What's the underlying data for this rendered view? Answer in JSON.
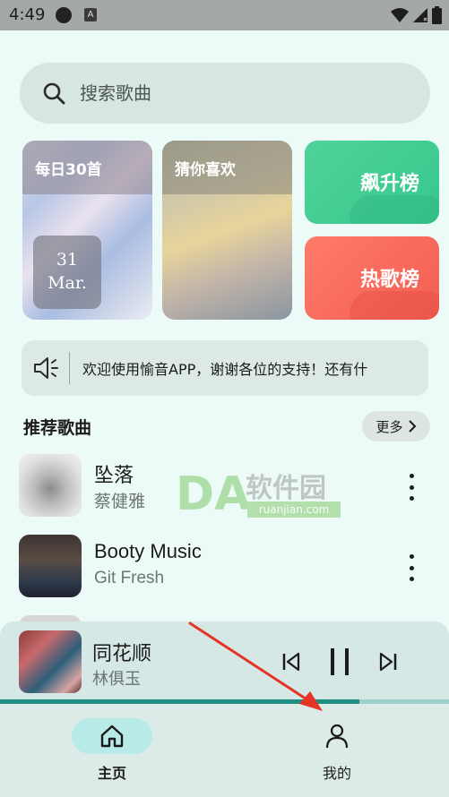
{
  "status_bar": {
    "time": "4:49",
    "a_badge": "A"
  },
  "search": {
    "placeholder": "搜索歌曲"
  },
  "cards": {
    "daily": {
      "title": "每日30首",
      "day": "31",
      "month": "Mar."
    },
    "guess": {
      "title": "猜你喜欢"
    },
    "rising": {
      "title": "飙升榜",
      "color": "#3fcd93"
    },
    "hot": {
      "title": "热歌榜",
      "color": "#f7685b"
    }
  },
  "notice": {
    "text": "欢迎使用愉音APP，谢谢各位的支持！还有什"
  },
  "recommend": {
    "title": "推荐歌曲",
    "more_label": "更多",
    "songs": [
      {
        "title": "坠落",
        "artist": "蔡健雅"
      },
      {
        "title": "Booty Music",
        "artist": "Git Fresh"
      }
    ]
  },
  "watermark": {
    "cn": "软件园",
    "url": "ruanjian.com",
    "letters": "DA"
  },
  "player": {
    "title": "同花顺",
    "artist": "林俱玉",
    "progress": 0.8
  },
  "nav": {
    "home_label": "主页",
    "mine_label": "我的"
  },
  "colors": {
    "accent": "#1f8f82",
    "background": "#ecfbf8",
    "arrow": "#e53325"
  }
}
